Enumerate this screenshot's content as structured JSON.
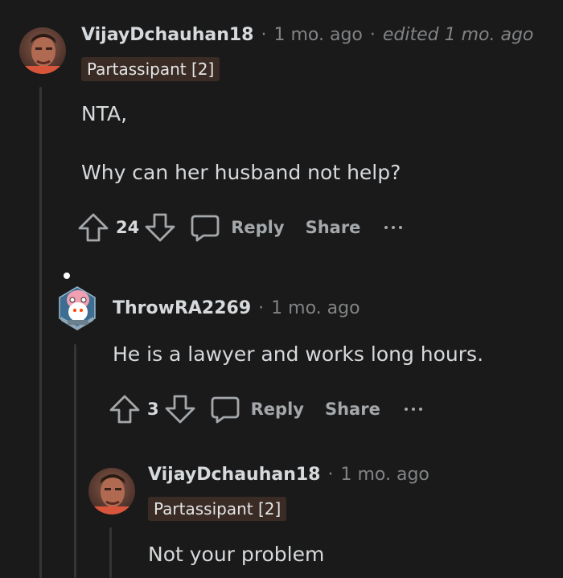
{
  "comments": [
    {
      "username": "VijayDchauhan18",
      "time": "1 mo. ago",
      "edited": "edited 1 mo. ago",
      "flair": "Partassipant [2]",
      "body": [
        "NTA,",
        "Why can her husband not help?"
      ],
      "votes": "24",
      "reply_label": "Reply",
      "share_label": "Share"
    },
    {
      "username": "ThrowRA2269",
      "time": "1 mo. ago",
      "body": [
        "He is a lawyer and works long hours."
      ],
      "votes": "3",
      "reply_label": "Reply",
      "share_label": "Share"
    },
    {
      "username": "VijayDchauhan18",
      "time": "1 mo. ago",
      "flair": "Partassipant [2]",
      "body": [
        "Not your problem"
      ]
    }
  ],
  "separator": "·",
  "colors": {
    "background": "#1a1a1b",
    "text": "#d7dadc",
    "muted": "#818384",
    "flair_bg": "#3a2b24",
    "thread_line": "#343536"
  }
}
